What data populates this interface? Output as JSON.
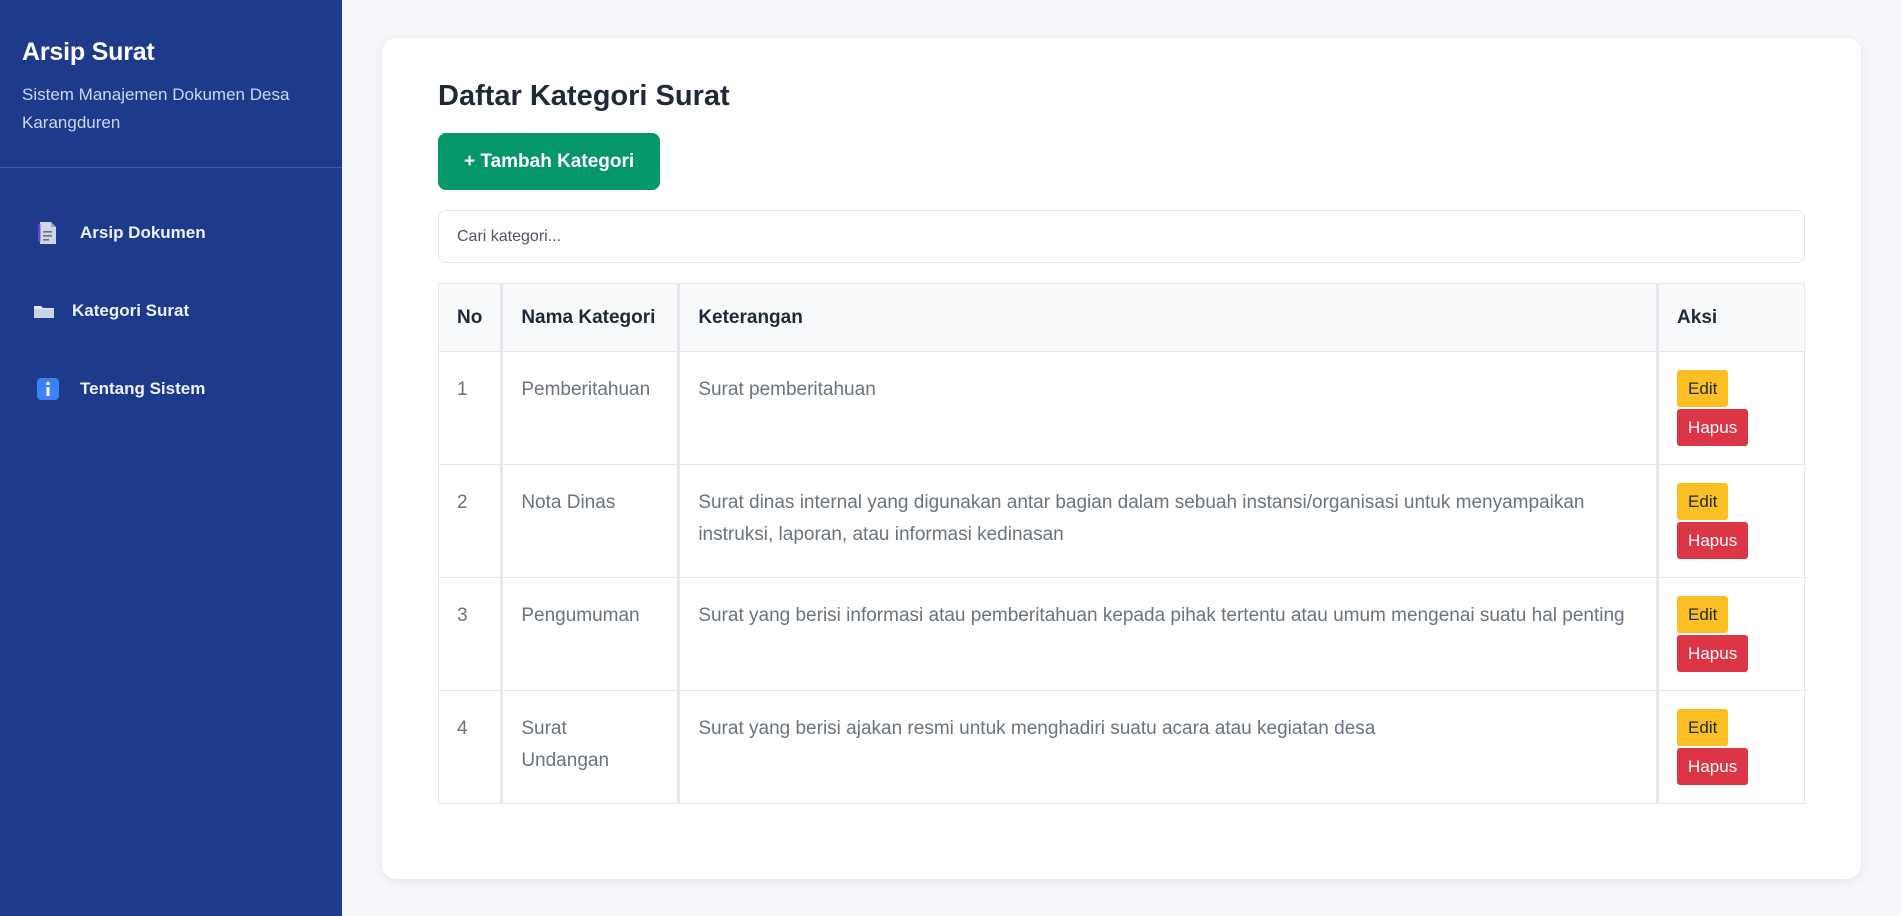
{
  "sidebar": {
    "title": "Arsip Surat",
    "subtitle": "Sistem Manajemen Dokumen Desa Karangduren",
    "items": [
      {
        "label": "Arsip Dokumen",
        "icon": "document-icon"
      },
      {
        "label": "Kategori Surat",
        "icon": "folder-icon"
      },
      {
        "label": "Tentang Sistem",
        "icon": "info-icon"
      }
    ]
  },
  "main": {
    "title": "Daftar Kategori Surat",
    "add_button": "+ Tambah Kategori",
    "search_placeholder": "Cari kategori...",
    "table": {
      "headers": [
        "No",
        "Nama Kategori",
        "Keterangan",
        "Aksi"
      ],
      "rows": [
        {
          "no": "1",
          "nama": "Pemberitahuan",
          "ket": "Surat pemberitahuan"
        },
        {
          "no": "2",
          "nama": "Nota Dinas",
          "ket": "Surat dinas internal yang digunakan antar bagian dalam sebuah instansi/organisasi untuk menyampaikan instruksi, laporan, atau informasi kedinasan"
        },
        {
          "no": "3",
          "nama": "Pengumuman",
          "ket": "Surat yang berisi informasi atau pemberitahuan kepada pihak tertentu atau umum mengenai suatu hal penting"
        },
        {
          "no": "4",
          "nama": "Surat Undangan",
          "ket": "Surat yang berisi ajakan resmi untuk menghadiri suatu acara atau kegiatan desa"
        }
      ],
      "edit_label": "Edit",
      "delete_label": "Hapus"
    }
  },
  "colors": {
    "sidebar_bg": "#1e3a8a",
    "primary_green": "#059669",
    "edit_yellow": "#fbbf24",
    "delete_red": "#dc3545"
  }
}
